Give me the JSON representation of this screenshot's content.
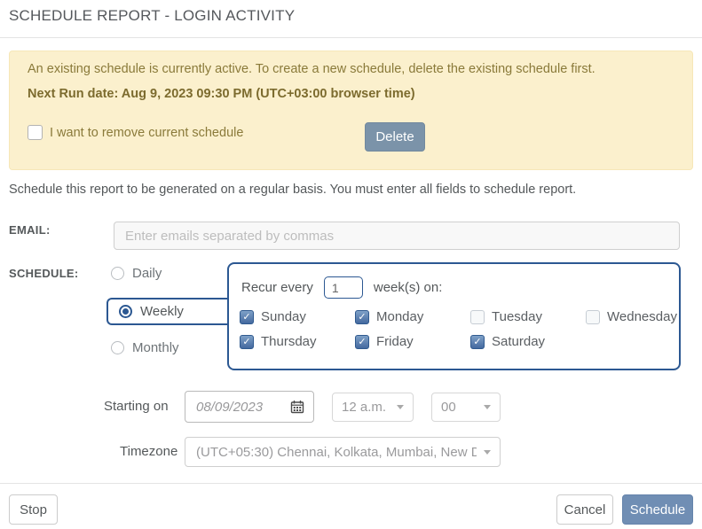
{
  "dialog": {
    "title": "SCHEDULE REPORT - LOGIN ACTIVITY"
  },
  "banner": {
    "message": "An existing schedule is currently active. To create a new schedule, delete the existing schedule first.",
    "next_run": "Next Run date: Aug 9, 2023 09:30 PM (UTC+03:00 browser time)",
    "remove_checkbox_label": "I want to remove current schedule",
    "remove_checked": false,
    "delete_button": "Delete"
  },
  "intro": "Schedule this report to be generated on a regular basis. You must enter all fields to schedule report.",
  "email": {
    "label": "EMAIL:",
    "value": "",
    "placeholder": "Enter emails separated by commas"
  },
  "schedule": {
    "label": "SCHEDULE:",
    "options": [
      {
        "label": "Daily",
        "selected": false
      },
      {
        "label": "Weekly",
        "selected": true
      },
      {
        "label": "Monthly",
        "selected": false
      }
    ]
  },
  "recur": {
    "prefix": "Recur every",
    "interval": "1",
    "suffix": "week(s) on:",
    "days": [
      {
        "label": "Sunday",
        "checked": true
      },
      {
        "label": "Monday",
        "checked": true
      },
      {
        "label": "Tuesday",
        "checked": false
      },
      {
        "label": "Wednesday",
        "checked": false
      },
      {
        "label": "Thursday",
        "checked": true
      },
      {
        "label": "Friday",
        "checked": true
      },
      {
        "label": "Saturday",
        "checked": true
      }
    ]
  },
  "starting": {
    "label": "Starting on",
    "date_value": "08/09/2023",
    "hour_value": "12 a.m.",
    "minute_value": "00"
  },
  "timezone": {
    "label": "Timezone",
    "value": "(UTC+05:30) Chennai, Kolkata, Mumbai, New D..."
  },
  "footer": {
    "stop": "Stop",
    "cancel": "Cancel",
    "schedule": "Schedule"
  },
  "colors": {
    "banner_bg": "#fbf0cd",
    "banner_text": "#8a7a3a",
    "accent_blue": "#2c5892",
    "delete_button": "#7b93a9",
    "schedule_button": "#708eb4"
  }
}
